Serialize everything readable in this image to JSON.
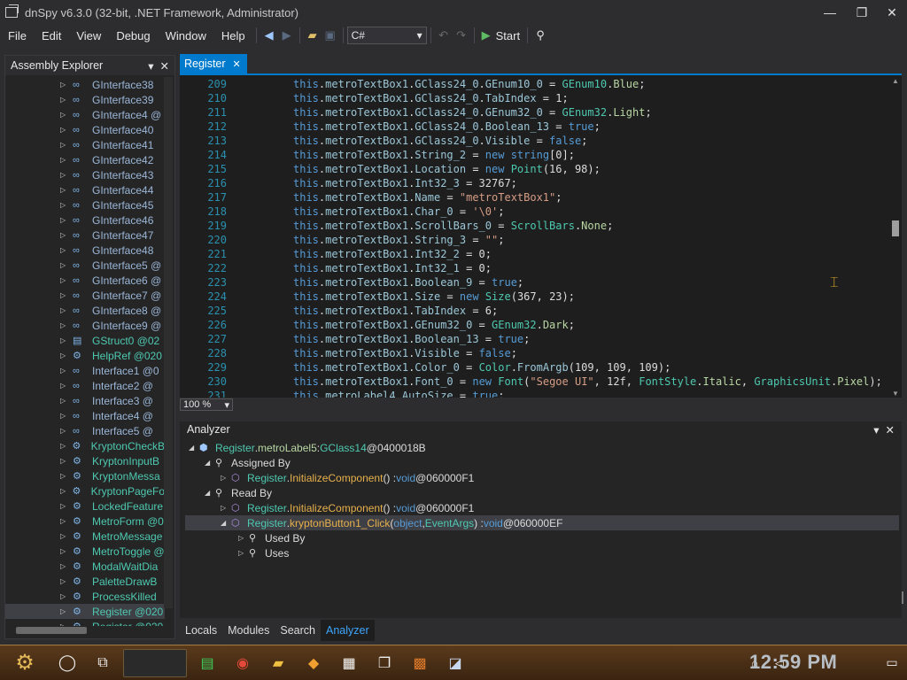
{
  "window": {
    "title": "dnSpy v6.3.0 (32-bit, .NET Framework, Administrator)",
    "minimize": "—",
    "maximize": "❐",
    "close": "✕"
  },
  "menu": {
    "items": [
      "File",
      "Edit",
      "View",
      "Debug",
      "Window",
      "Help"
    ],
    "language": "C#",
    "start_label": "Start"
  },
  "assembly_explorer": {
    "title": "Assembly Explorer",
    "items": [
      {
        "label": "GInterface38",
        "icon": "interface-icon"
      },
      {
        "label": "GInterface39",
        "icon": "interface-icon"
      },
      {
        "label": "GInterface4 @",
        "icon": "interface-icon"
      },
      {
        "label": "GInterface40",
        "icon": "interface-icon"
      },
      {
        "label": "GInterface41",
        "icon": "interface-icon"
      },
      {
        "label": "GInterface42",
        "icon": "interface-icon"
      },
      {
        "label": "GInterface43",
        "icon": "interface-icon"
      },
      {
        "label": "GInterface44",
        "icon": "interface-icon"
      },
      {
        "label": "GInterface45",
        "icon": "interface-icon"
      },
      {
        "label": "GInterface46",
        "icon": "interface-icon"
      },
      {
        "label": "GInterface47",
        "icon": "interface-icon"
      },
      {
        "label": "GInterface48",
        "icon": "interface-icon"
      },
      {
        "label": "GInterface5 @",
        "icon": "interface-icon"
      },
      {
        "label": "GInterface6 @",
        "icon": "interface-icon"
      },
      {
        "label": "GInterface7 @",
        "icon": "interface-icon"
      },
      {
        "label": "GInterface8 @",
        "icon": "interface-icon"
      },
      {
        "label": "GInterface9 @",
        "icon": "interface-icon"
      },
      {
        "label": "GStruct0 @02",
        "icon": "struct-icon"
      },
      {
        "label": "HelpRef @020",
        "icon": "class-icon"
      },
      {
        "label": "Interface1 @0",
        "icon": "interface-icon"
      },
      {
        "label": "Interface2 @",
        "icon": "interface-icon"
      },
      {
        "label": "Interface3 @",
        "icon": "interface-icon"
      },
      {
        "label": "Interface4 @",
        "icon": "interface-icon"
      },
      {
        "label": "Interface5 @",
        "icon": "interface-icon"
      },
      {
        "label": "KryptonCheckB",
        "icon": "class-icon"
      },
      {
        "label": "KryptonInputB",
        "icon": "class-icon"
      },
      {
        "label": "KryptonMessa",
        "icon": "class-icon"
      },
      {
        "label": "KryptonPageFo",
        "icon": "class-icon"
      },
      {
        "label": "LockedFeature",
        "icon": "class-icon"
      },
      {
        "label": "MetroForm @0",
        "icon": "class-icon"
      },
      {
        "label": "MetroMessage",
        "icon": "class-icon"
      },
      {
        "label": "MetroToggle @",
        "icon": "class-icon"
      },
      {
        "label": "ModalWaitDia",
        "icon": "class-icon"
      },
      {
        "label": "PaletteDrawB",
        "icon": "class-icon"
      },
      {
        "label": "ProcessKilled",
        "icon": "class-icon"
      },
      {
        "label": "Register @020",
        "icon": "class-icon",
        "selected": true
      },
      {
        "label": "Register @020",
        "icon": "class-icon"
      }
    ]
  },
  "editor": {
    "tab_label": "Register",
    "zoom": "100 %",
    "lines": [
      {
        "n": "209",
        "text": "this.metroTextBox1.GClass24_0.GEnum10_0 = GEnum10.Blue;"
      },
      {
        "n": "210",
        "text": "this.metroTextBox1.GClass24_0.TabIndex = 1;"
      },
      {
        "n": "211",
        "text": "this.metroTextBox1.GClass24_0.GEnum32_0 = GEnum32.Light;"
      },
      {
        "n": "212",
        "text": "this.metroTextBox1.GClass24_0.Boolean_13 = true;"
      },
      {
        "n": "213",
        "text": "this.metroTextBox1.GClass24_0.Visible = false;"
      },
      {
        "n": "214",
        "text": "this.metroTextBox1.String_2 = new string[0];"
      },
      {
        "n": "215",
        "text": "this.metroTextBox1.Location = new Point(16, 98);"
      },
      {
        "n": "216",
        "text": "this.metroTextBox1.Int32_3 = 32767;"
      },
      {
        "n": "217",
        "text": "this.metroTextBox1.Name = \"metroTextBox1\";"
      },
      {
        "n": "218",
        "text": "this.metroTextBox1.Char_0 = '\\0';"
      },
      {
        "n": "219",
        "text": "this.metroTextBox1.ScrollBars_0 = ScrollBars.None;"
      },
      {
        "n": "220",
        "text": "this.metroTextBox1.String_3 = \"\";"
      },
      {
        "n": "221",
        "text": "this.metroTextBox1.Int32_2 = 0;"
      },
      {
        "n": "222",
        "text": "this.metroTextBox1.Int32_1 = 0;"
      },
      {
        "n": "223",
        "text": "this.metroTextBox1.Boolean_9 = true;"
      },
      {
        "n": "224",
        "text": "this.metroTextBox1.Size = new Size(367, 23);"
      },
      {
        "n": "225",
        "text": "this.metroTextBox1.TabIndex = 6;"
      },
      {
        "n": "226",
        "text": "this.metroTextBox1.GEnum32_0 = GEnum32.Dark;"
      },
      {
        "n": "227",
        "text": "this.metroTextBox1.Boolean_13 = true;"
      },
      {
        "n": "228",
        "text": "this.metroTextBox1.Visible = false;"
      },
      {
        "n": "229",
        "text": "this.metroTextBox1.Color_0 = Color.FromArgb(109, 109, 109);"
      },
      {
        "n": "230",
        "text": "this.metroTextBox1.Font_0 = new Font(\"Segoe UI\", 12f, FontStyle.Italic, GraphicsUnit.Pixel);"
      },
      {
        "n": "231",
        "text": "this.metroLabel4.AutoSize = true;"
      }
    ]
  },
  "analyzer": {
    "title": "Analyzer",
    "root": {
      "type": "Register",
      "member": "metroLabel5",
      "sep": " : ",
      "ftype": "GClass14",
      "token": " @0400018B"
    },
    "assigned_by": "Assigned By",
    "assigned_item": {
      "type": "Register",
      "method": "InitializeComponent",
      "sig": "() : ",
      "ret": "void",
      "token": " @060000F1"
    },
    "read_by": "Read By",
    "read_item1": {
      "type": "Register",
      "method": "InitializeComponent",
      "sig": "() : ",
      "ret": "void",
      "token": " @060000F1"
    },
    "read_item2": {
      "type": "Register",
      "method": "kryptonButton1_Click",
      "p1": "object",
      "p2": "EventArgs",
      "ret": "void",
      "token": " @060000EF"
    },
    "used_by": "Used By",
    "uses": "Uses"
  },
  "bottom_tabs": [
    "Locals",
    "Modules",
    "Search",
    "Analyzer"
  ],
  "taskbar": {
    "clock": "12:59 PM"
  },
  "colors": {
    "accent": "#007acc",
    "background": "#1e1e1e"
  }
}
